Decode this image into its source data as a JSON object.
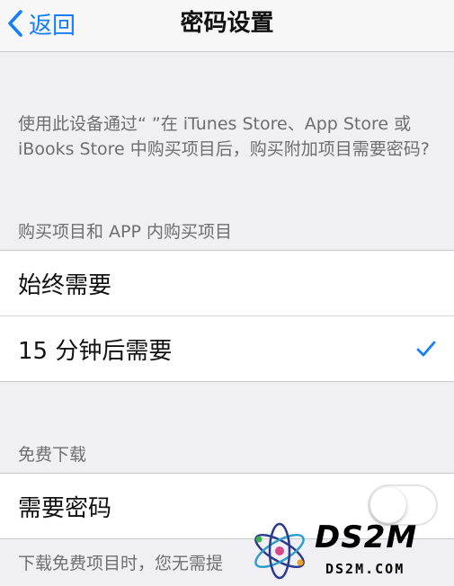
{
  "nav": {
    "back_label": "返回",
    "title": "密码设置"
  },
  "description": "使用此设备通过“ ”在 iTunes Store、App Store 或 iBooks Store 中购买项目后，购买附加项目需要密码?",
  "purchase_section": {
    "header": "购买项目和 APP 内购买项目",
    "options": [
      {
        "label": "始终需要",
        "selected": false
      },
      {
        "label": "15 分钟后需要",
        "selected": true
      }
    ]
  },
  "free_section": {
    "header": "免费下载",
    "require_password_label": "需要密码",
    "require_password_on": false,
    "footer": "下载免费项目时，您无需提"
  },
  "watermark": {
    "brand": "DS2M",
    "domain": "DS2M.COM"
  },
  "colors": {
    "accent": "#147efb",
    "background": "#efeff4",
    "secondary_text": "#6d6d72"
  }
}
